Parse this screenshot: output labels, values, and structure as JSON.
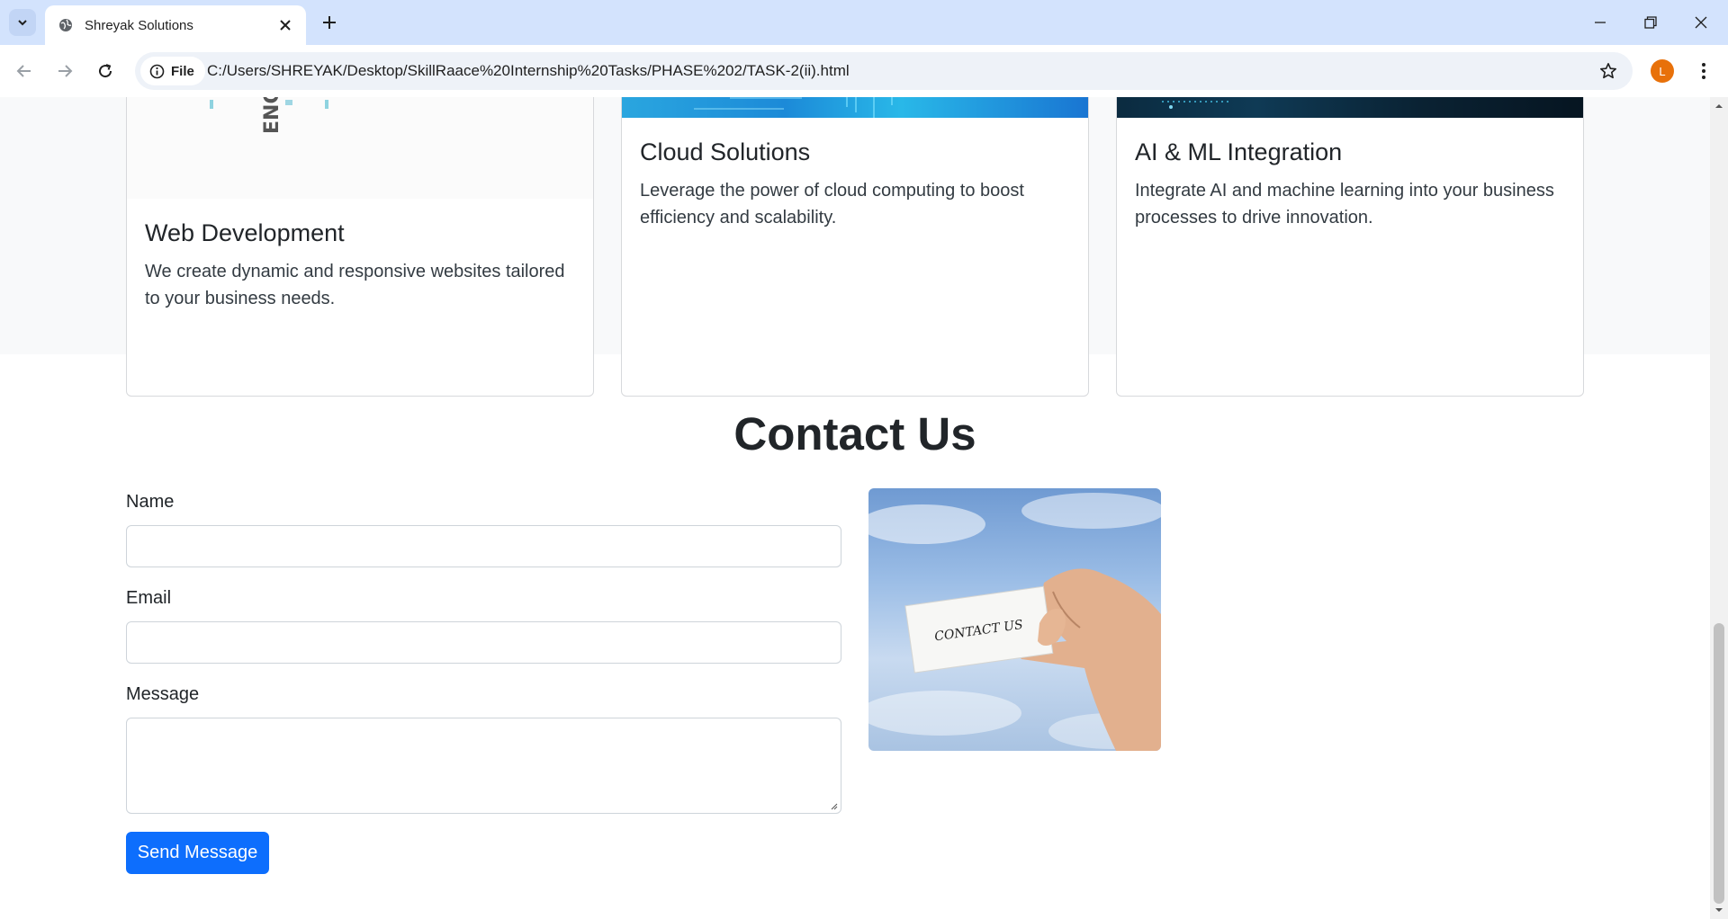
{
  "browser": {
    "tab_title": "Shreyak Solutions",
    "url_chip": "File",
    "url": "C:/Users/SHREYAK/Desktop/SkillRaace%20Internship%20Tasks/PHASE%202/TASK-2(ii).html",
    "profile_initial": "L"
  },
  "services": {
    "cards": [
      {
        "title": "Web Development",
        "text": "We create dynamic and responsive websites tailored to your business needs.",
        "image_text": "ENG"
      },
      {
        "title": "Cloud Solutions",
        "text": "Leverage the power of cloud computing to boost efficiency and scalability."
      },
      {
        "title": "AI & ML Integration",
        "text": "Integrate AI and machine learning into your business processes to drive innovation."
      }
    ]
  },
  "contact": {
    "title": "Contact Us",
    "name_label": "Name",
    "email_label": "Email",
    "message_label": "Message",
    "submit_label": "Send Message",
    "image_card_text": "CONTACT US"
  },
  "colors": {
    "primary_button": "#0d6efd",
    "section_bg": "#f8f9fa",
    "tabbar_bg": "#d3e3fd",
    "avatar_bg": "#e8710a"
  },
  "icons": [
    "tab-list-icon",
    "globe-icon",
    "close-icon",
    "plus-icon",
    "minimize-icon",
    "restore-icon",
    "window-close-icon",
    "back-arrow-icon",
    "forward-arrow-icon",
    "reload-icon",
    "info-icon",
    "star-icon",
    "kebab-menu-icon"
  ]
}
